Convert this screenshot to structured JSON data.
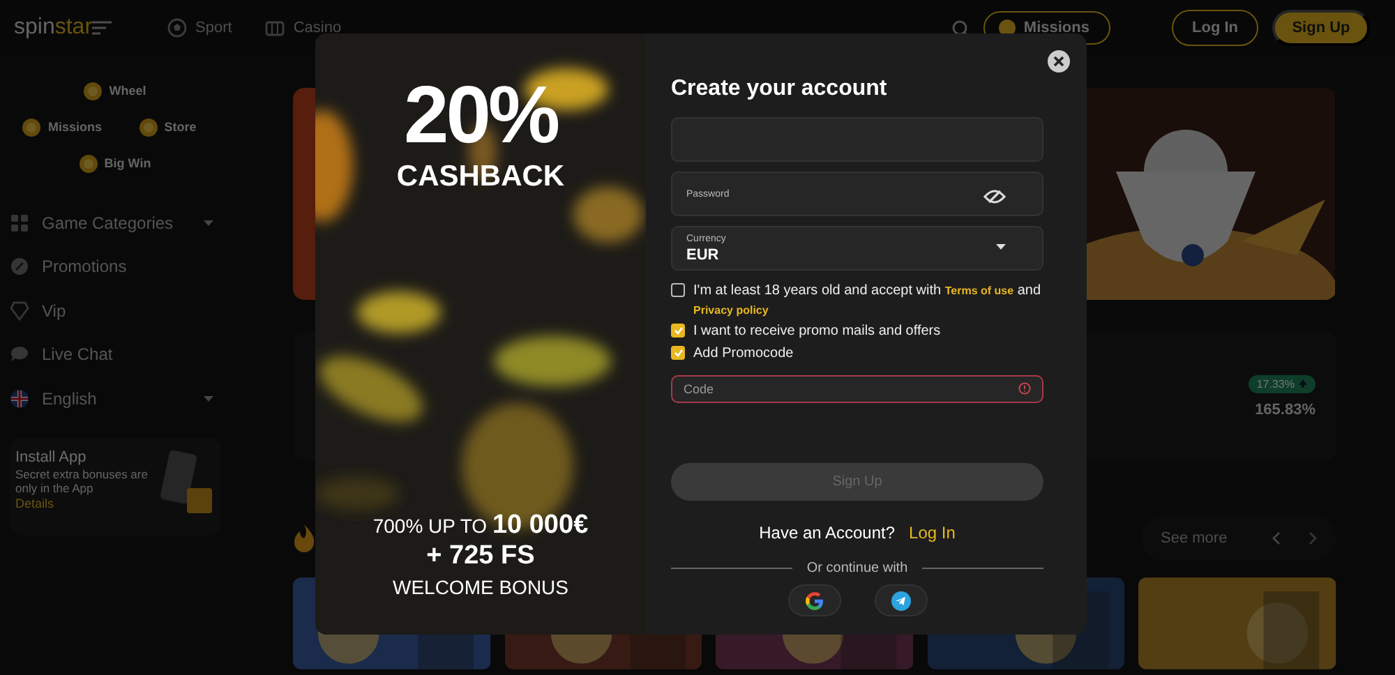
{
  "header": {
    "logo": [
      {
        "kind": "plain",
        "text": "spin"
      },
      {
        "kind": "accent",
        "text": "star"
      }
    ],
    "nav": [
      {
        "label": "Sport"
      },
      {
        "label": "Casino"
      }
    ],
    "missions_button": "Missions",
    "login_button": "Log In",
    "signup_button": "Sign Up"
  },
  "sidebar": {
    "quick_links": [
      {
        "label": "Wheel"
      },
      {
        "label": "Missions"
      },
      {
        "label": "Store"
      },
      {
        "label": "Big Win"
      }
    ],
    "menu": [
      {
        "label": "Game Categories",
        "expandable": true
      },
      {
        "label": "Promotions",
        "expandable": false
      },
      {
        "label": "Vip",
        "expandable": false
      },
      {
        "label": "Live Chat",
        "expandable": false
      },
      {
        "label": "English",
        "expandable": true
      }
    ],
    "install_app": {
      "title": "Install App",
      "text": "Secret extra bonuses are only in the App",
      "link": "Details"
    }
  },
  "main": {
    "stat_badge": "17.33%",
    "stat_value": "165.83%",
    "see_more": "See more"
  },
  "modal": {
    "promo": {
      "percent": "20%",
      "headline": "CASHBACK",
      "offer_prefix": "700% UP TO",
      "offer_amount": "10 000€",
      "free_spins": "+ 725 FS",
      "caption": "WELCOME BONUS"
    },
    "title": "Create your account",
    "fields": [
      {
        "kind": "input"
      },
      {
        "kind": "password",
        "label": "Password"
      },
      {
        "kind": "select",
        "label": "Currency",
        "value": "EUR"
      }
    ],
    "checkboxes": [
      {
        "checked": false,
        "parts": [
          {
            "kind": "text",
            "text": "I'm at least 18 years old and accept with "
          },
          {
            "kind": "link",
            "text": "Terms of use"
          },
          {
            "kind": "text",
            "text": " and "
          },
          {
            "kind": "link",
            "text": "Privacy policy"
          }
        ]
      },
      {
        "checked": true,
        "parts": [
          {
            "kind": "text",
            "text": "I want to receive promo mails and offers"
          }
        ]
      },
      {
        "checked": true,
        "parts": [
          {
            "kind": "text",
            "text": "Add Promocode"
          }
        ]
      }
    ],
    "promo_field": {
      "placeholder": "Code",
      "error": true
    },
    "submit": {
      "label": "Sign Up",
      "disabled": true
    },
    "login_prompt": {
      "text": "Have an Account?",
      "link": "Log In"
    },
    "divider": "Or continue with",
    "social": [
      {
        "kind": "google"
      },
      {
        "kind": "telegram"
      }
    ]
  }
}
